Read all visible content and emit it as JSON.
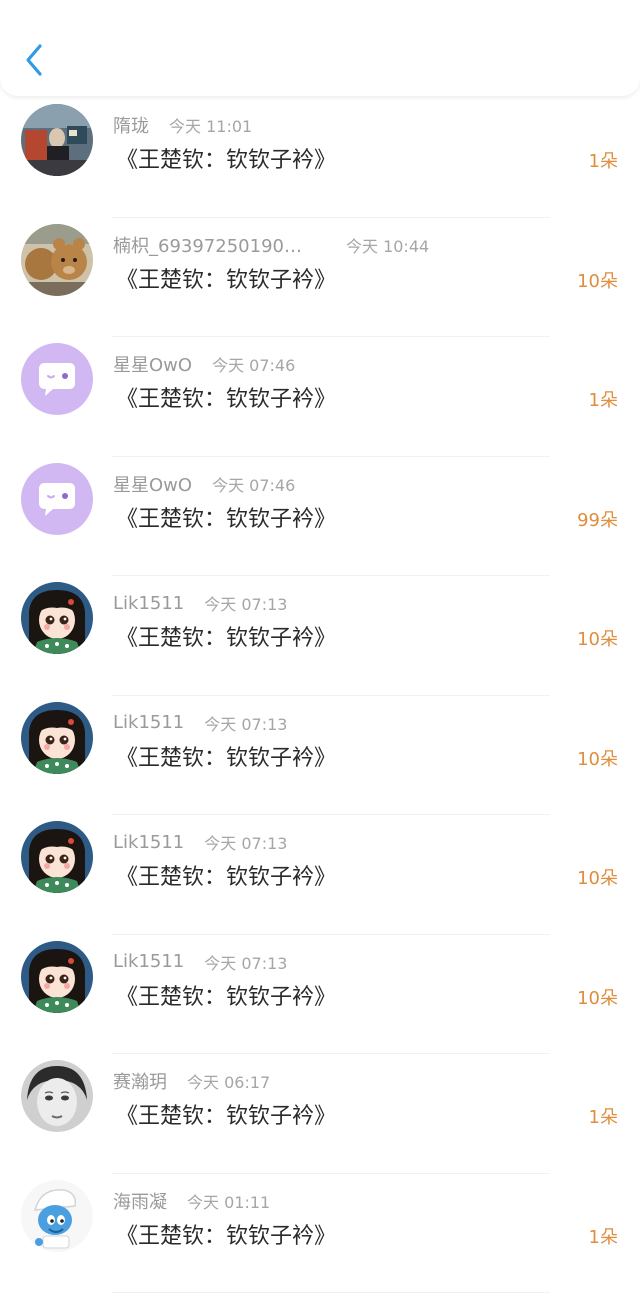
{
  "nav": {
    "back_icon": "chevron-left-icon",
    "accent_color": "#2f9be8"
  },
  "colors": {
    "count": "#e08d3c",
    "name": "#9a9a9a",
    "gift": "#2a2a2a"
  },
  "gifts": [
    {
      "user": "隋珑",
      "time": "今天 11:01",
      "gift": "《王楚钦：钦钦子衿》",
      "count": "1朵",
      "avatar": "photo-avatar-street"
    },
    {
      "user": "楠枳_69397250190…",
      "time": "今天 10:44",
      "gift": "《王楚钦：钦钦子衿》",
      "count": "10朵",
      "avatar": "teddy-bear-avatar"
    },
    {
      "user": "星星OwO",
      "time": "今天 07:46",
      "gift": "《王楚钦：钦钦子衿》",
      "count": "1朵",
      "avatar": "default-chat-bubble-avatar"
    },
    {
      "user": "星星OwO",
      "time": "今天 07:46",
      "gift": "《王楚钦：钦钦子衿》",
      "count": "99朵",
      "avatar": "default-chat-bubble-avatar"
    },
    {
      "user": "Lik1511",
      "time": "今天 07:13",
      "gift": "《王楚钦：钦钦子衿》",
      "count": "10朵",
      "avatar": "anime-girl-avatar"
    },
    {
      "user": "Lik1511",
      "time": "今天 07:13",
      "gift": "《王楚钦：钦钦子衿》",
      "count": "10朵",
      "avatar": "anime-girl-avatar"
    },
    {
      "user": "Lik1511",
      "time": "今天 07:13",
      "gift": "《王楚钦：钦钦子衿》",
      "count": "10朵",
      "avatar": "anime-girl-avatar"
    },
    {
      "user": "Lik1511",
      "time": "今天 07:13",
      "gift": "《王楚钦：钦钦子衿》",
      "count": "10朵",
      "avatar": "anime-girl-avatar"
    },
    {
      "user": "赛瀚玥",
      "time": "今天 06:17",
      "gift": "《王楚钦：钦钦子衿》",
      "count": "1朵",
      "avatar": "vintage-portrait-avatar"
    },
    {
      "user": "海雨凝",
      "time": "今天 01:11",
      "gift": "《王楚钦：钦钦子衿》",
      "count": "1朵",
      "avatar": "smurf-avatar"
    }
  ]
}
